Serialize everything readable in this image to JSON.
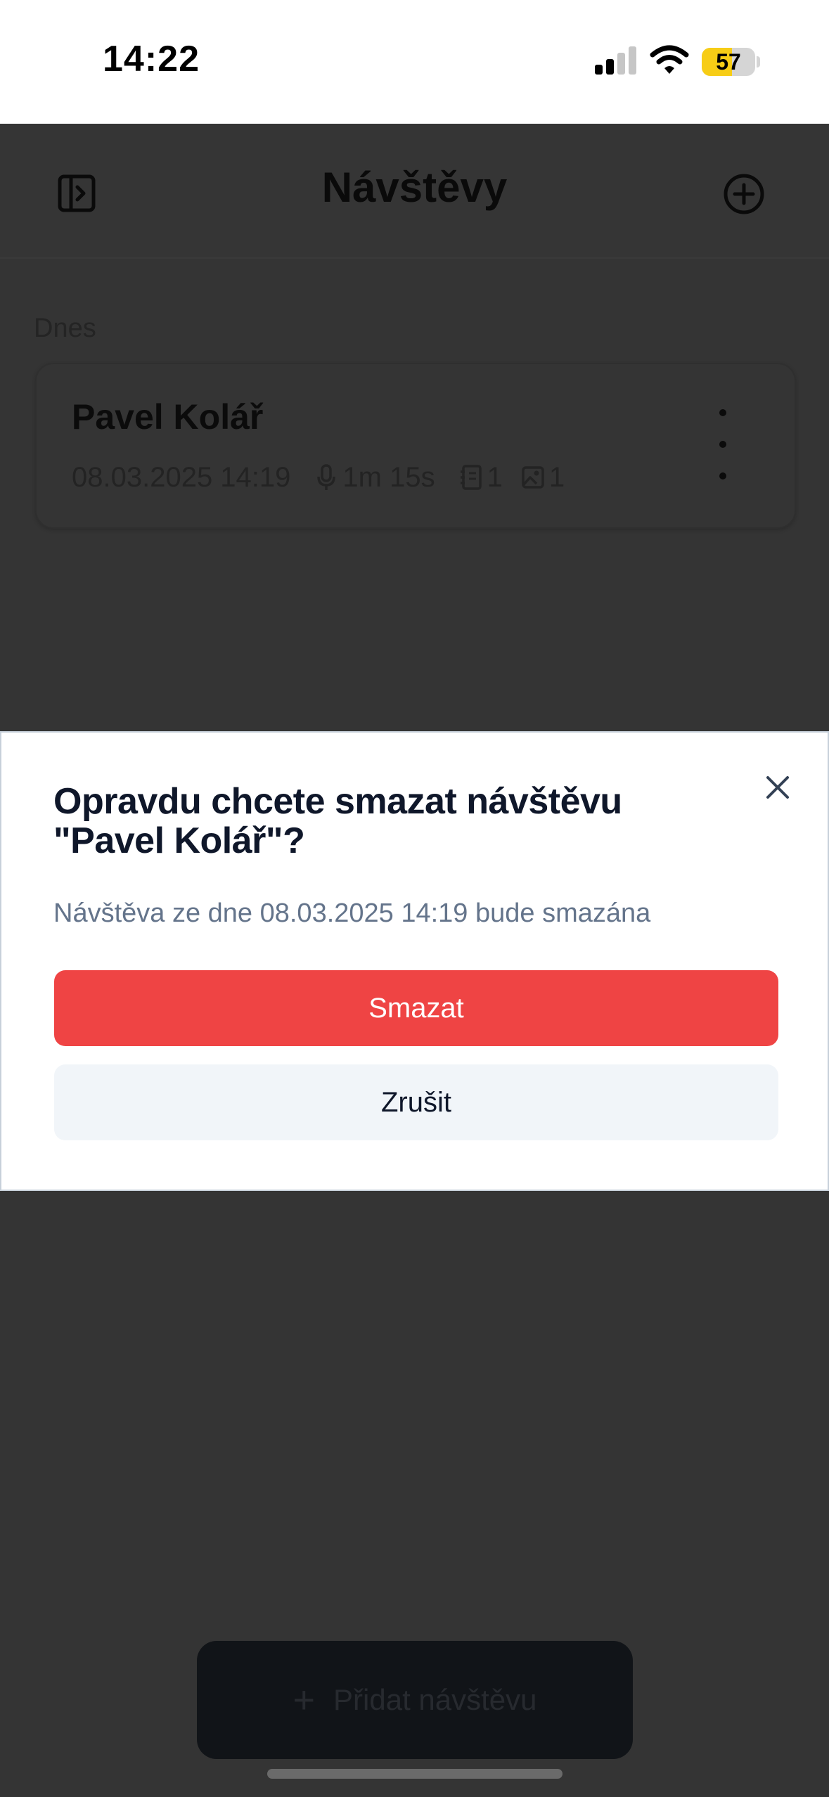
{
  "status_bar": {
    "time": "14:22",
    "battery_percent": "57",
    "battery_level": 0.57,
    "icons": [
      "signal-icon",
      "wifi-icon",
      "battery-icon"
    ]
  },
  "header": {
    "title": "Návštěvy",
    "left_icon": "sidebar-toggle-icon",
    "right_icon": "plus-circle-icon"
  },
  "section": {
    "label": "Dnes"
  },
  "visits": [
    {
      "name": "Pavel Kolář",
      "datetime": "08.03.2025 14:19",
      "duration": "1m 15s",
      "notes_count": "1",
      "images_count": "1",
      "icons": [
        "microphone-icon",
        "notebook-icon",
        "image-icon",
        "more-vertical-icon"
      ]
    }
  ],
  "fab": {
    "label": "Přidat návštěvu",
    "icon": "plus-icon"
  },
  "dialog": {
    "title": "Opravdu chcete smazat návštěvu \"Pavel Kolář\"?",
    "description": "Návštěva ze dne 08.03.2025 14:19 bude smazána",
    "confirm_label": "Smazat",
    "cancel_label": "Zrušit",
    "close_icon": "close-icon"
  },
  "colors": {
    "overlay": "#343434",
    "danger": "#ef4444",
    "secondary_button": "#f1f5f9",
    "title_text": "#0f172a",
    "muted_text": "#64748b",
    "battery_fill": "#f7cd16"
  }
}
